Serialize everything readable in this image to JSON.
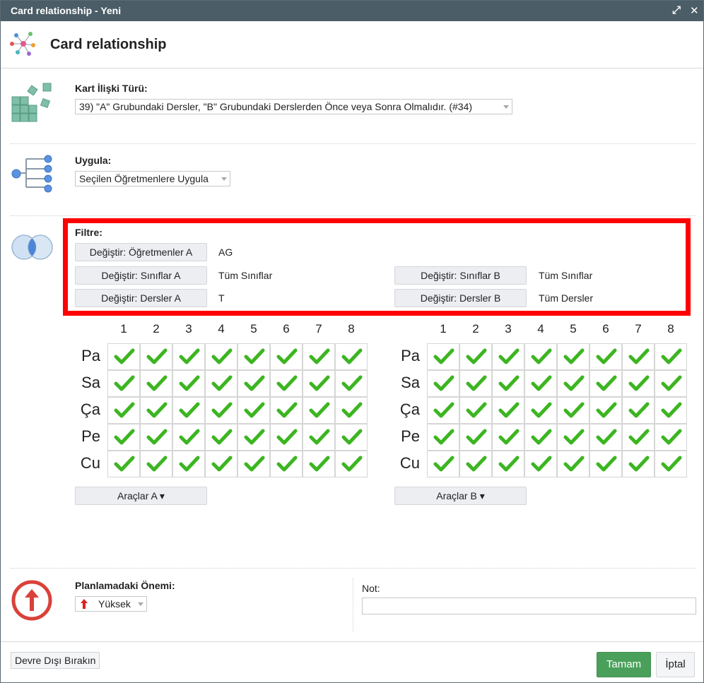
{
  "window": {
    "title": "Card relationship - Yeni"
  },
  "header": {
    "title": "Card relationship"
  },
  "relation_type": {
    "label": "Kart İlişki Türü:",
    "value": "39) \"A\" Grubundaki Dersler, \"B\" Grubundaki Derslerden Önce veya Sonra Olmalıdır. (#34)"
  },
  "apply": {
    "label": "Uygula:",
    "value": "Seçilen Öğretmenlere Uygula"
  },
  "filter": {
    "label": "Filtre:",
    "teachers_a": {
      "button": "Değiştir: Öğretmenler A",
      "value": "AG"
    },
    "classes_a": {
      "button": "Değiştir: Sınıflar A",
      "value": "Tüm Sınıflar"
    },
    "subjects_a": {
      "button": "Değiştir: Dersler A",
      "value": "T"
    },
    "classes_b": {
      "button": "Değiştir: Sınıflar B",
      "value": "Tüm Sınıflar"
    },
    "subjects_b": {
      "button": "Değiştir: Dersler B",
      "value": "Tüm Dersler"
    }
  },
  "grids": {
    "periods": [
      "1",
      "2",
      "3",
      "4",
      "5",
      "6",
      "7",
      "8"
    ],
    "days": [
      "Pa",
      "Sa",
      "Ça",
      "Pe",
      "Cu"
    ],
    "check_color": "#3cb521",
    "all_checked": true
  },
  "tools": {
    "a_label": "Araçlar A ▾",
    "b_label": "Araçlar B ▾"
  },
  "importance": {
    "label": "Planlamadaki Önemi:",
    "value": "Yüksek",
    "arrow_color": "#e02020"
  },
  "note": {
    "label": "Not:",
    "value": ""
  },
  "footer": {
    "disable_label": "Devre Dışı Bırakın",
    "ok_label": "Tamam",
    "cancel_label": "İptal"
  },
  "colors": {
    "titlebar": "#4b5d67",
    "highlight_box": "#ff0000",
    "ok_button": "#4aa05a"
  }
}
